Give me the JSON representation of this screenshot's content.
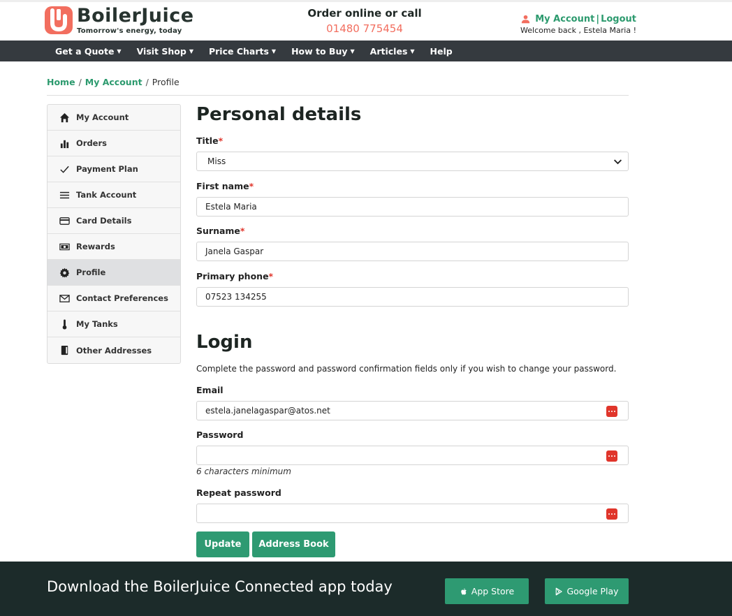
{
  "brand": {
    "name": "BoilerJuice",
    "tagline": "Tomorrow's energy, today",
    "accent": "#2e9a72",
    "logo_color": "#f26e5f"
  },
  "header": {
    "order_title": "Order online or call",
    "phone": "01480 775454",
    "my_account": "My Account",
    "separator": "|",
    "logout": "Logout",
    "welcome": "Welcome back , Estela Maria !"
  },
  "nav": [
    {
      "label": "Get a Quote",
      "icon": "caret-down-icon"
    },
    {
      "label": "Visit Shop",
      "icon": "caret-down-icon"
    },
    {
      "label": "Price Charts",
      "icon": "caret-down-icon"
    },
    {
      "label": "How to Buy",
      "icon": "caret-down-icon"
    },
    {
      "label": "Articles",
      "icon": "caret-down-icon"
    },
    {
      "label": "Help"
    }
  ],
  "breadcrumb": {
    "home": "Home",
    "my_account": "My Account",
    "current": "Profile",
    "sep": "/"
  },
  "sidebar": [
    {
      "label": "My Account",
      "icon": "home-icon"
    },
    {
      "label": "Orders",
      "icon": "bar-chart-icon"
    },
    {
      "label": "Payment Plan",
      "icon": "check-icon"
    },
    {
      "label": "Tank Account",
      "icon": "menu-lines-icon"
    },
    {
      "label": "Card Details",
      "icon": "credit-card-icon"
    },
    {
      "label": "Rewards",
      "icon": "banknote-icon"
    },
    {
      "label": "Profile",
      "icon": "gear-icon",
      "active": true
    },
    {
      "label": "Contact Preferences",
      "icon": "envelope-icon"
    },
    {
      "label": "My Tanks",
      "icon": "thermometer-icon"
    },
    {
      "label": "Other Addresses",
      "icon": "address-book-icon"
    }
  ],
  "personal": {
    "heading": "Personal details",
    "required_mark": "*",
    "title_label": "Title",
    "title_value": "Miss",
    "first_name_label": "First name",
    "first_name_value": "Estela Maria",
    "surname_label": "Surname",
    "surname_value": "Janela Gaspar",
    "phone_label": "Primary phone",
    "phone_value": "07523 134255"
  },
  "login": {
    "heading": "Login",
    "note": "Complete the password and password confirmation fields only if you wish to change your password.",
    "email_label": "Email",
    "email_value": "estela.janelagaspar@atos.net",
    "password_label": "Password",
    "password_value": "",
    "password_hint": "6 characters minimum",
    "repeat_label": "Repeat password",
    "repeat_value": ""
  },
  "buttons": {
    "update": "Update",
    "address_book": "Address Book"
  },
  "footer": {
    "title": "Download the BoilerJuice Connected app today",
    "app_store": "App Store",
    "google_play": "Google Play"
  }
}
